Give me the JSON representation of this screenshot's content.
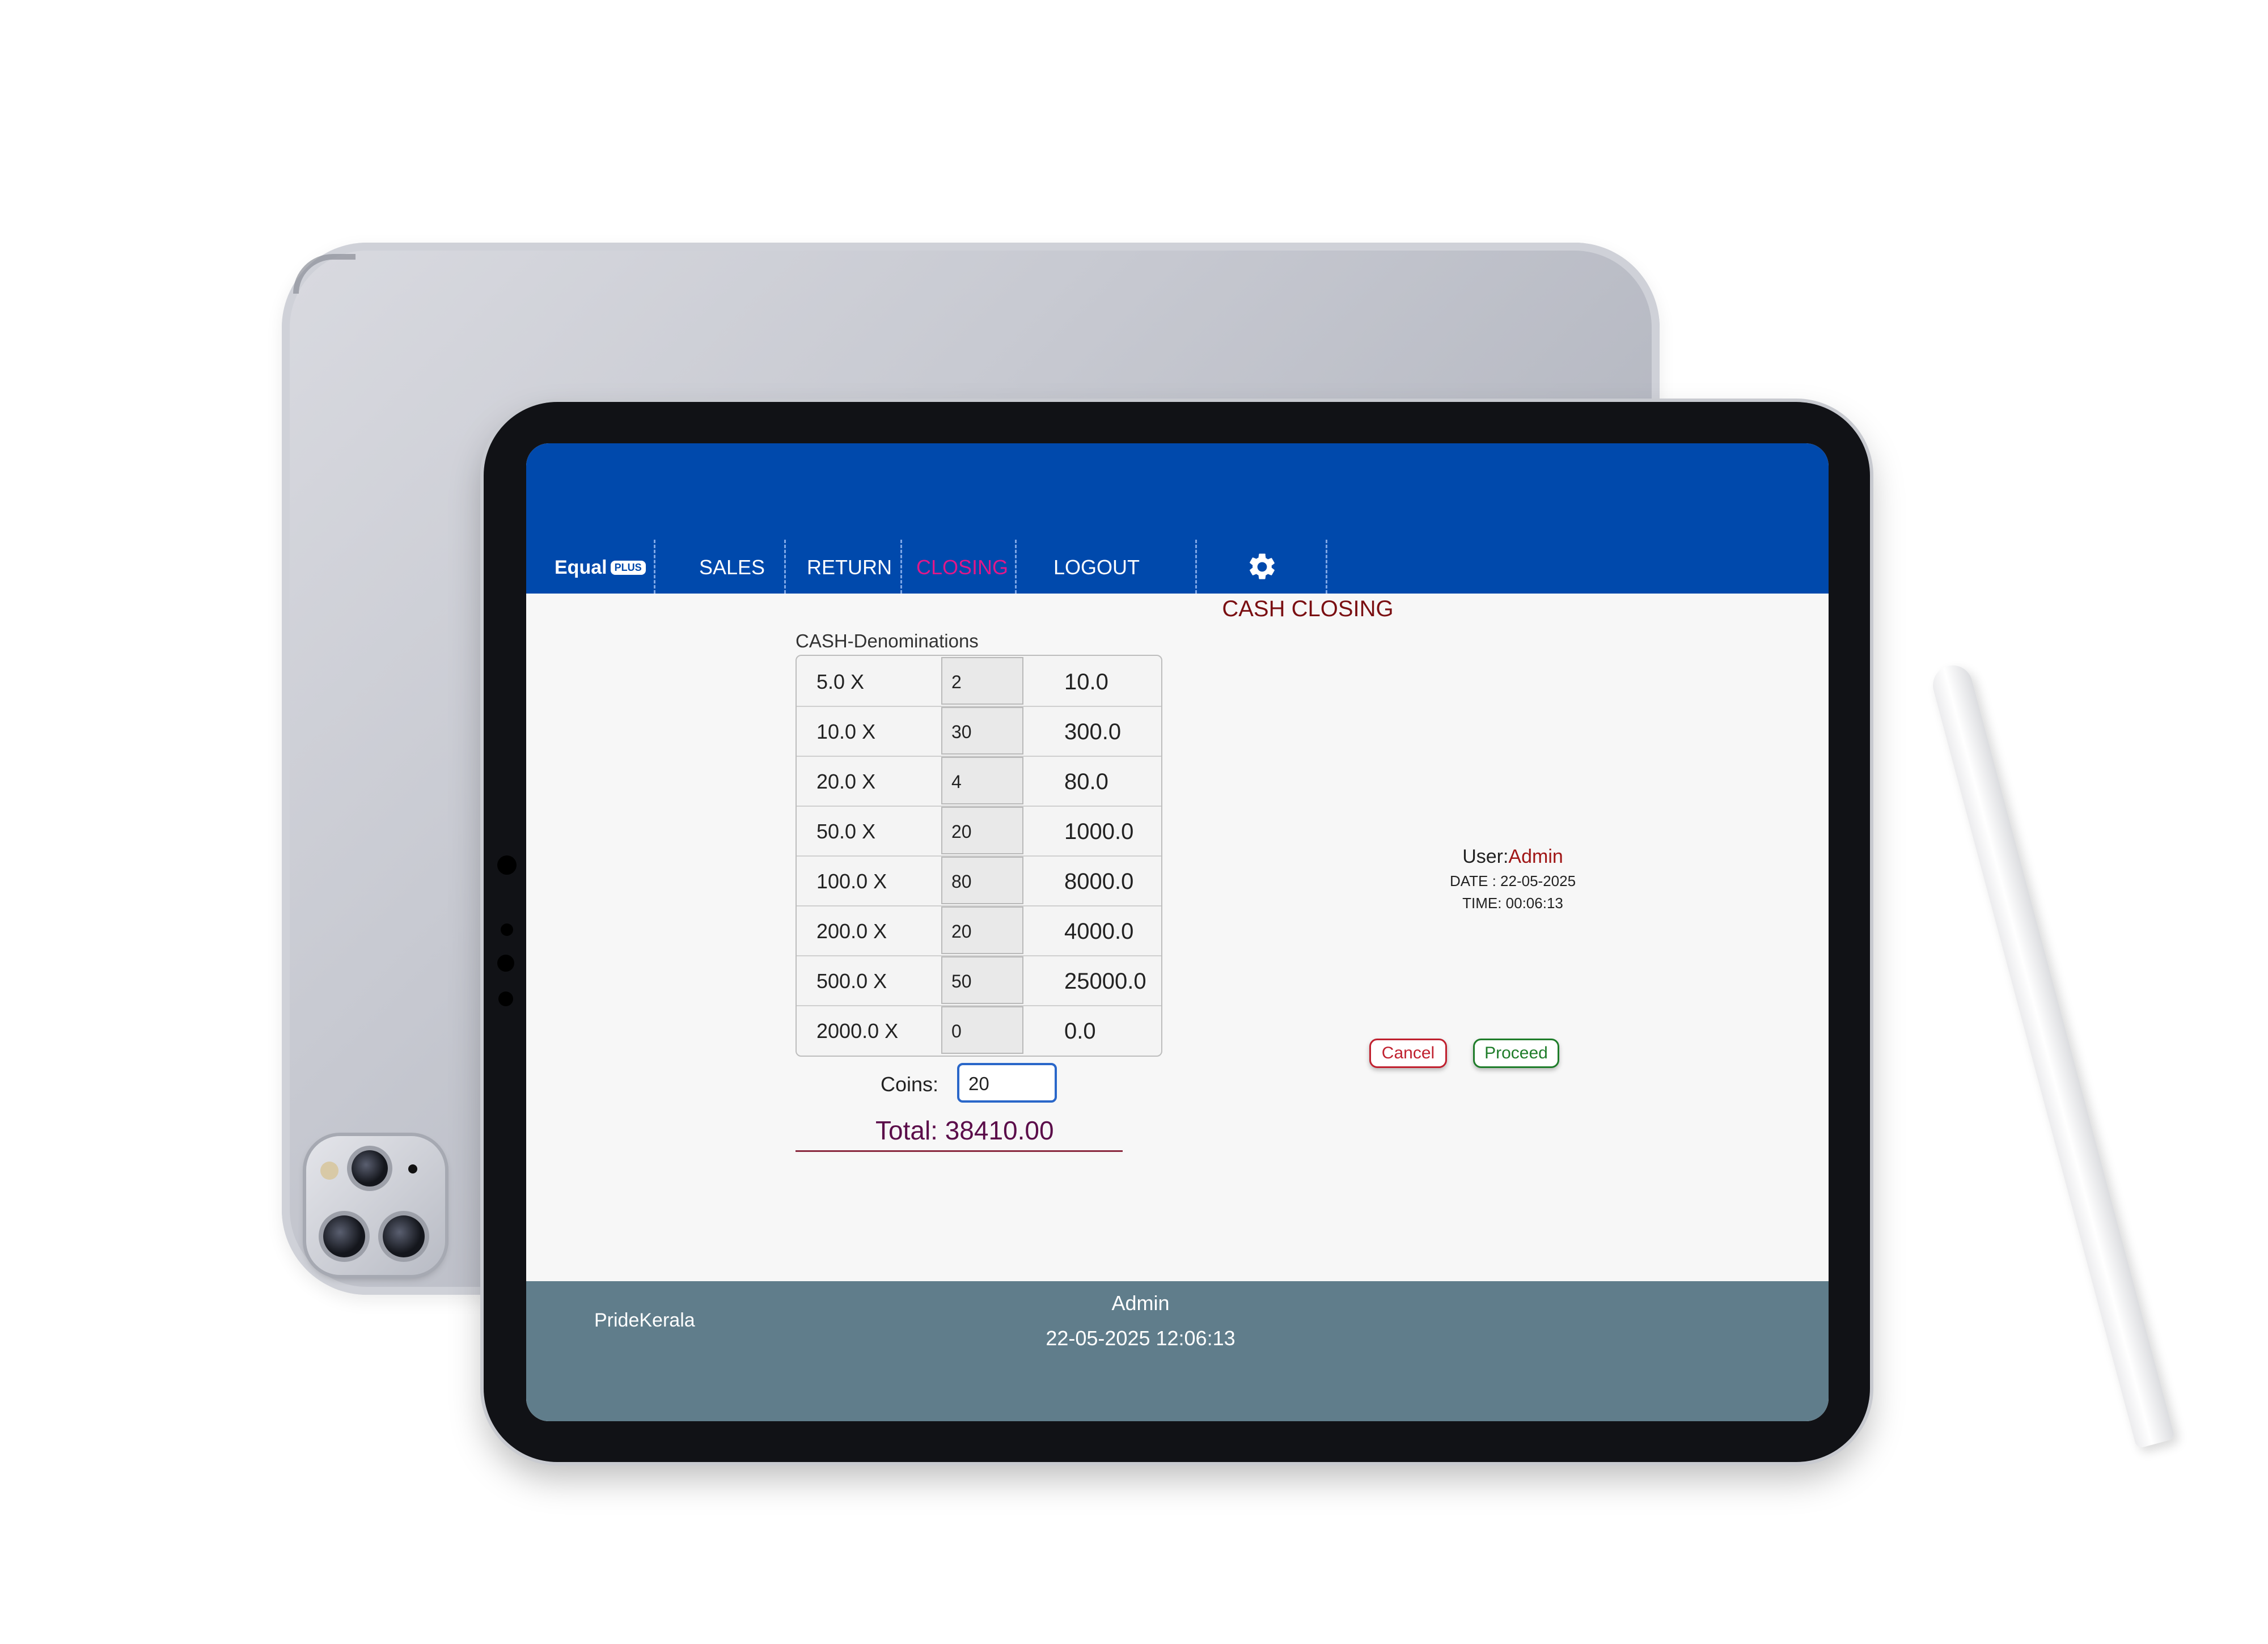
{
  "app": {
    "logo_text": "Equal",
    "logo_badge": "PLUS"
  },
  "nav": {
    "items": [
      {
        "label": "SALES"
      },
      {
        "label": "RETURN"
      },
      {
        "label": "CLOSING",
        "active": true
      },
      {
        "label": "LOGOUT"
      }
    ],
    "settings_icon": "gear-icon",
    "active_color": "#e0188a"
  },
  "page": {
    "title": "CASH CLOSING",
    "denominations_caption": "CASH-Denominations"
  },
  "denominations": [
    {
      "label": "5.0 X",
      "qty": "2",
      "amount": "10.0"
    },
    {
      "label": "10.0 X",
      "qty": "30",
      "amount": "300.0"
    },
    {
      "label": "20.0 X",
      "qty": "4",
      "amount": "80.0"
    },
    {
      "label": "50.0 X",
      "qty": "20",
      "amount": "1000.0"
    },
    {
      "label": "100.0 X",
      "qty": "80",
      "amount": "8000.0"
    },
    {
      "label": "200.0 X",
      "qty": "20",
      "amount": "4000.0"
    },
    {
      "label": "500.0 X",
      "qty": "50",
      "amount": "25000.0"
    },
    {
      "label": "2000.0 X",
      "qty": "0",
      "amount": "0.0"
    }
  ],
  "coins": {
    "label": "Coins:",
    "value": "20"
  },
  "total": {
    "text": "Total: 38410.00"
  },
  "session": {
    "user_label": "User:",
    "user_name": "Admin",
    "date_text": "DATE : 22-05-2025",
    "time_text": "TIME:  00:06:13"
  },
  "actions": {
    "cancel_label": "Cancel",
    "proceed_label": "Proceed"
  },
  "footer": {
    "store": "PrideKerala",
    "user": "Admin",
    "datetime": "22-05-2025 12:06:13"
  },
  "colors": {
    "topbar": "#0049ac",
    "footer": "#607d8b",
    "title": "#7a0f12",
    "cancel": "#c0212f",
    "proceed": "#1f7d2a"
  }
}
